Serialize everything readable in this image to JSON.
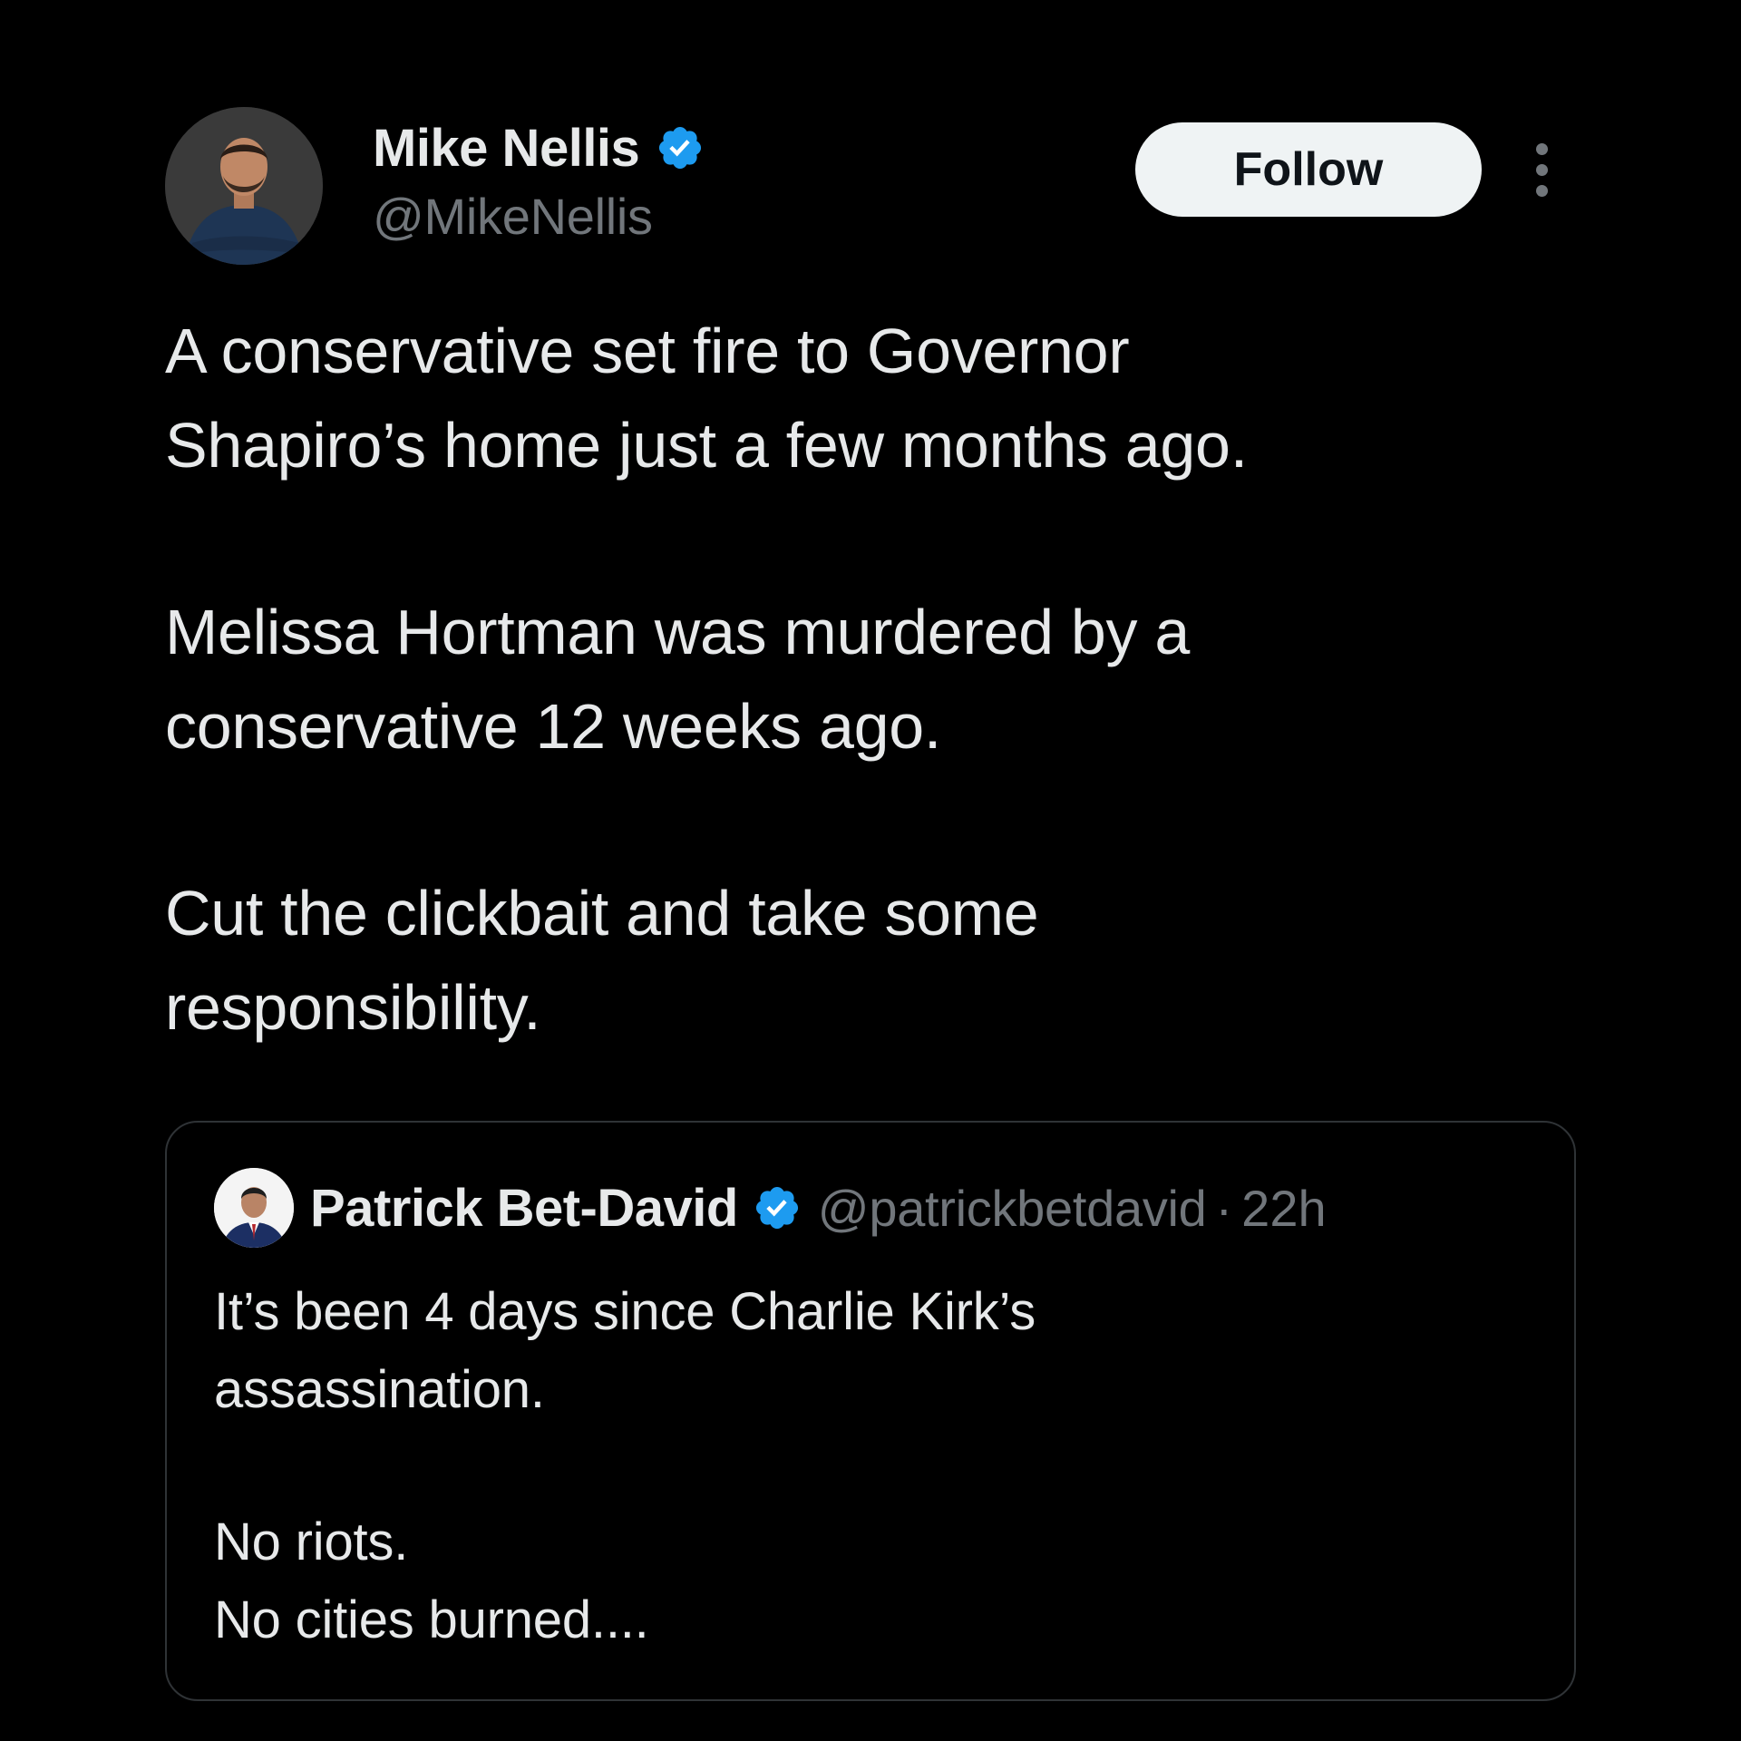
{
  "author": {
    "display_name": "Mike Nellis",
    "handle": "@MikeNellis",
    "verified": true,
    "avatar_icon": "profile-photo"
  },
  "actions": {
    "follow_label": "Follow",
    "more_icon": "more-vertical-icon"
  },
  "tweet": {
    "paragraphs": [
      [
        "A conservative set fire to Governor",
        "Shapiro’s home just a few months ago."
      ],
      [
        "Melissa Hortman was murdered by a",
        "conservative 12 weeks ago."
      ],
      [
        "Cut the clickbait and take some",
        "responsibility."
      ]
    ]
  },
  "quote": {
    "display_name": "Patrick Bet-David",
    "handle": "@patrickbetdavid",
    "separator": "·",
    "time": "22h",
    "verified": true,
    "paragraphs": [
      [
        "It’s been 4 days since Charlie Kirk’s",
        "assassination."
      ],
      [
        "No riots.",
        "No cities burned...."
      ]
    ]
  },
  "colors": {
    "background": "#000000",
    "text_primary": "#e7e9ea",
    "text_secondary": "#71767b",
    "verified_blue": "#1d9bf0",
    "follow_bg": "#eff3f4",
    "card_border": "#2f3336"
  }
}
